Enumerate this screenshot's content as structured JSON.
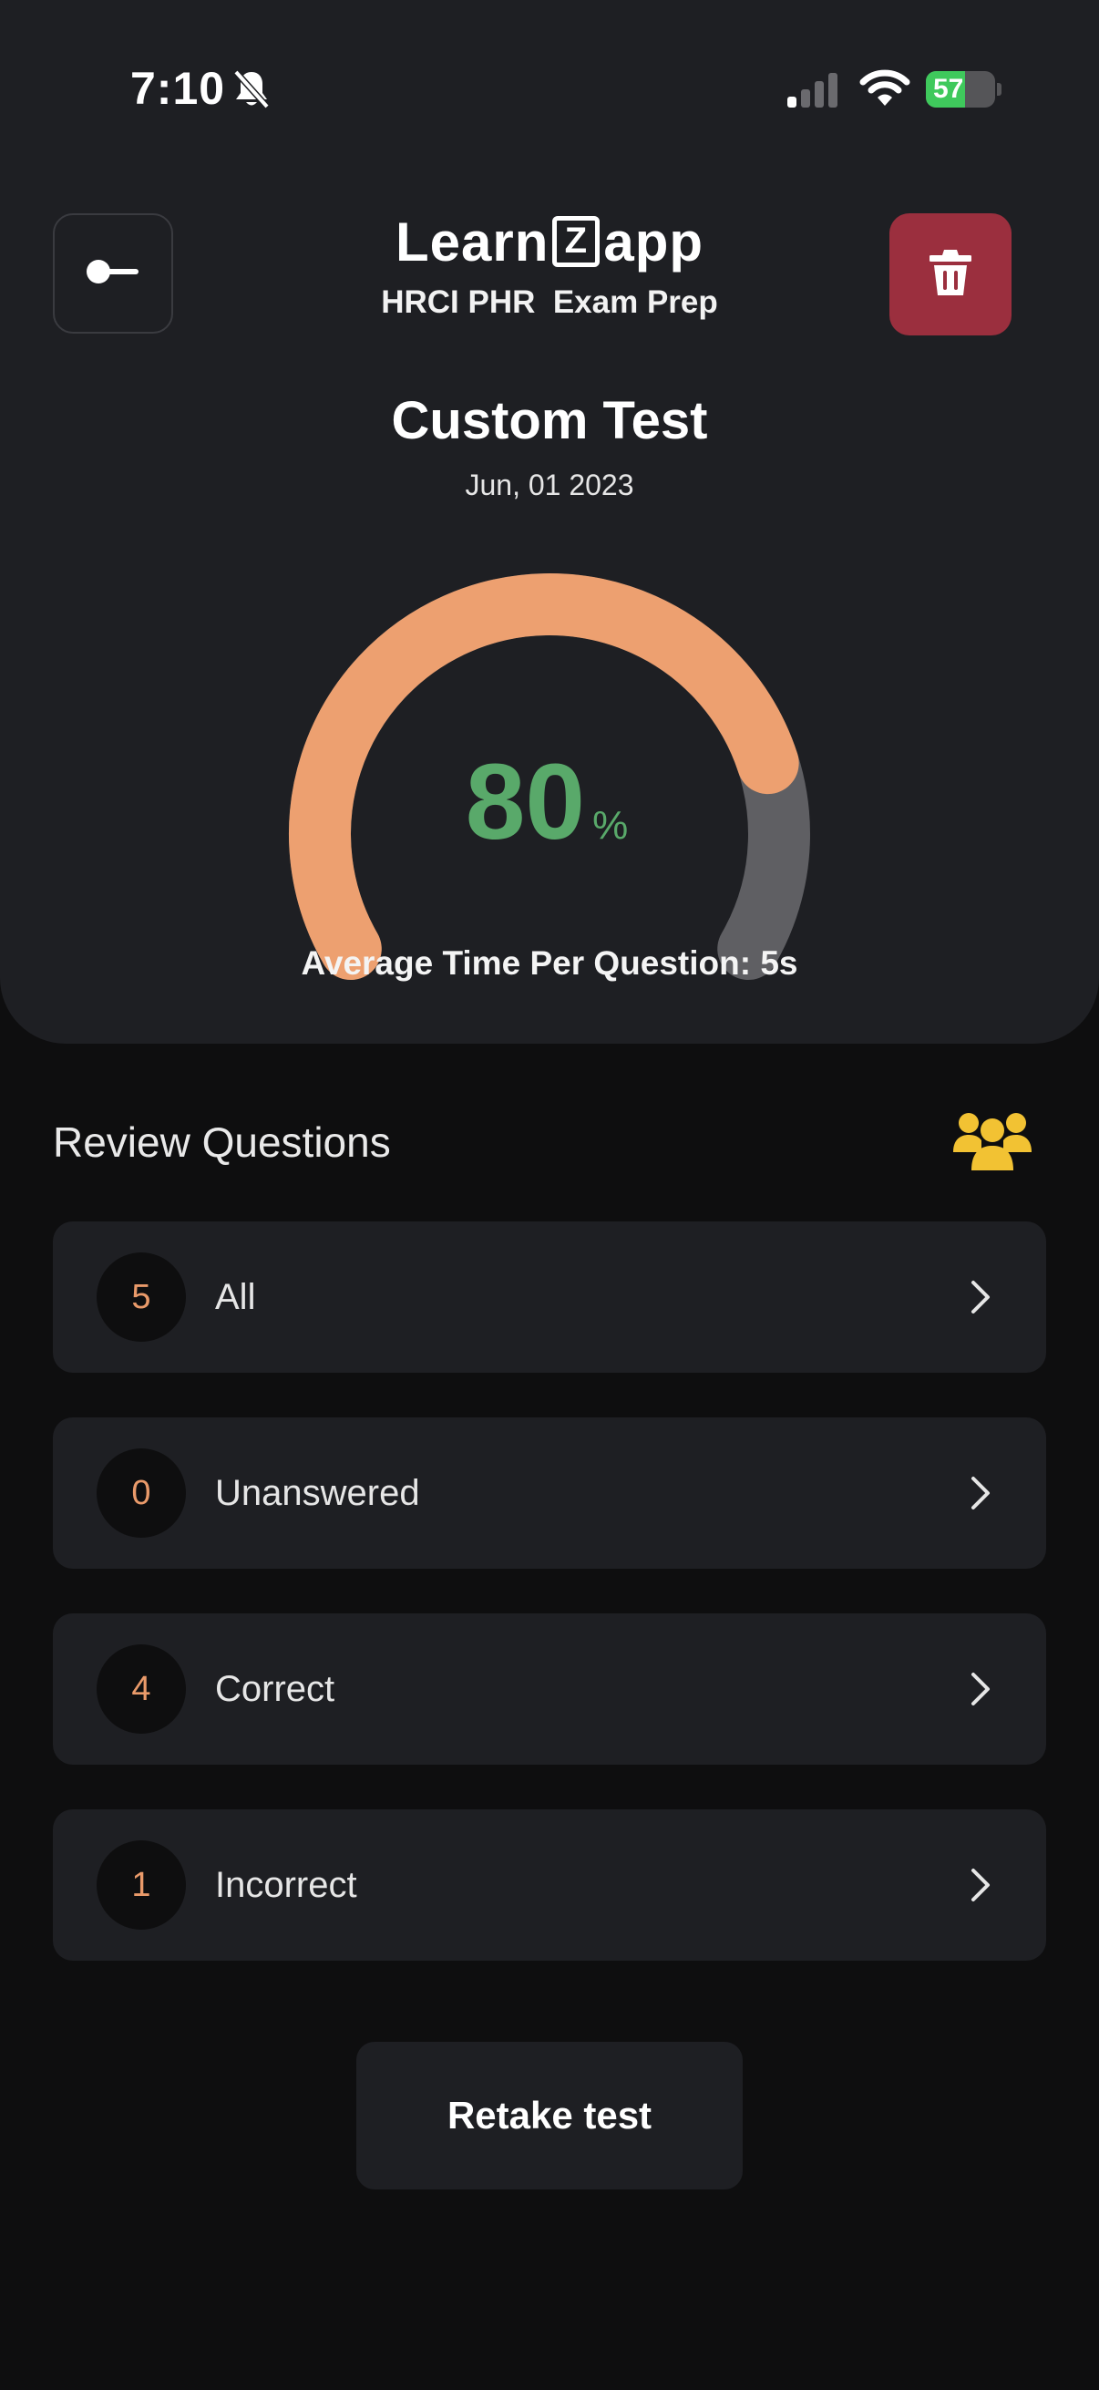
{
  "status_bar": {
    "time": "7:10",
    "battery_percent": "57",
    "battery_level": 0.57,
    "icons": [
      "bell-slash-icon",
      "signal-icon",
      "wifi-icon",
      "battery-charging-icon"
    ]
  },
  "header": {
    "logo_text_left": "Learn",
    "logo_text_mark": "Z",
    "logo_text_right": "app",
    "subtitle": "HRCI PHR  Exam Prep",
    "back_icon": "arrow-left-icon",
    "delete_icon": "trash-icon"
  },
  "result": {
    "title": "Custom Test",
    "date": "Jun, 01 2023",
    "score": "80",
    "score_unit": "%",
    "score_fraction": 0.8,
    "avg_time": "Average Time Per Question: 5s"
  },
  "review": {
    "title": "Review Questions",
    "icon": "group-icon",
    "items": [
      {
        "count": "5",
        "label": "All"
      },
      {
        "count": "0",
        "label": "Unanswered"
      },
      {
        "count": "4",
        "label": "Correct"
      },
      {
        "count": "1",
        "label": "Incorrect"
      }
    ]
  },
  "retake_label": "Retake test",
  "colors": {
    "background": "#0e0e0f",
    "panel": "#1e1f23",
    "accent_orange": "#eda070",
    "gauge_track": "#5f5f63",
    "score_green": "#59a96a",
    "delete_red": "#9b2f3e",
    "count_orange": "#e99a6a",
    "group_icon_yellow": "#f2c233",
    "battery_green": "#3fc95c"
  }
}
